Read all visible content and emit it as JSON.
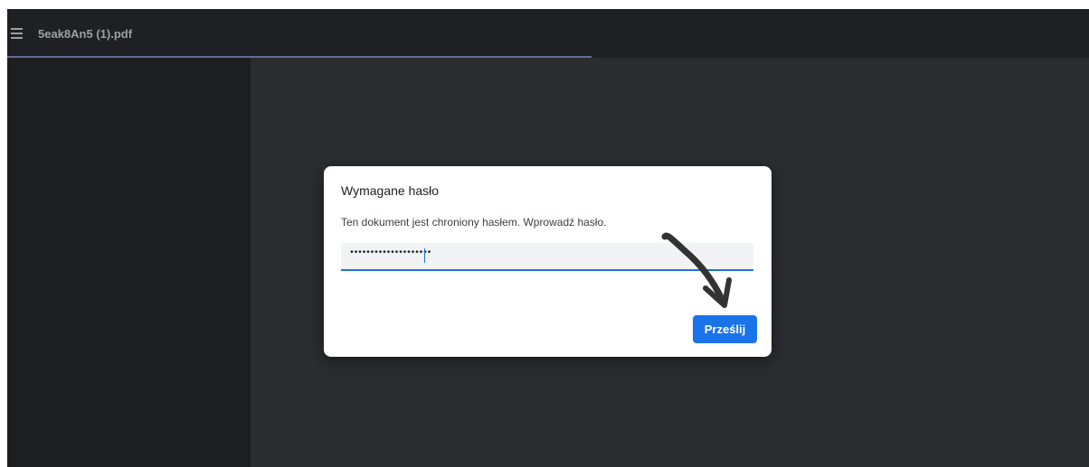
{
  "toolbar": {
    "menu_icon": "hamburger-menu-icon",
    "filename": "5eak8An5 (1).pdf",
    "load_progress": 0.54
  },
  "dialog": {
    "title": "Wymagane hasło",
    "message": "Ten dokument jest chroniony hasłem. Wprowadź hasło.",
    "password_masked": "••••••••••••••••••••",
    "submit_label": "Prześlij"
  },
  "annotation": {
    "icon": "hand-drawn-arrow-icon",
    "color": "#333333"
  },
  "colors": {
    "accent": "#1a73e8",
    "toolbar_bg": "#1f2023",
    "sidebar_bg": "#1d1e20",
    "viewer_bg": "#2b2c2f"
  }
}
